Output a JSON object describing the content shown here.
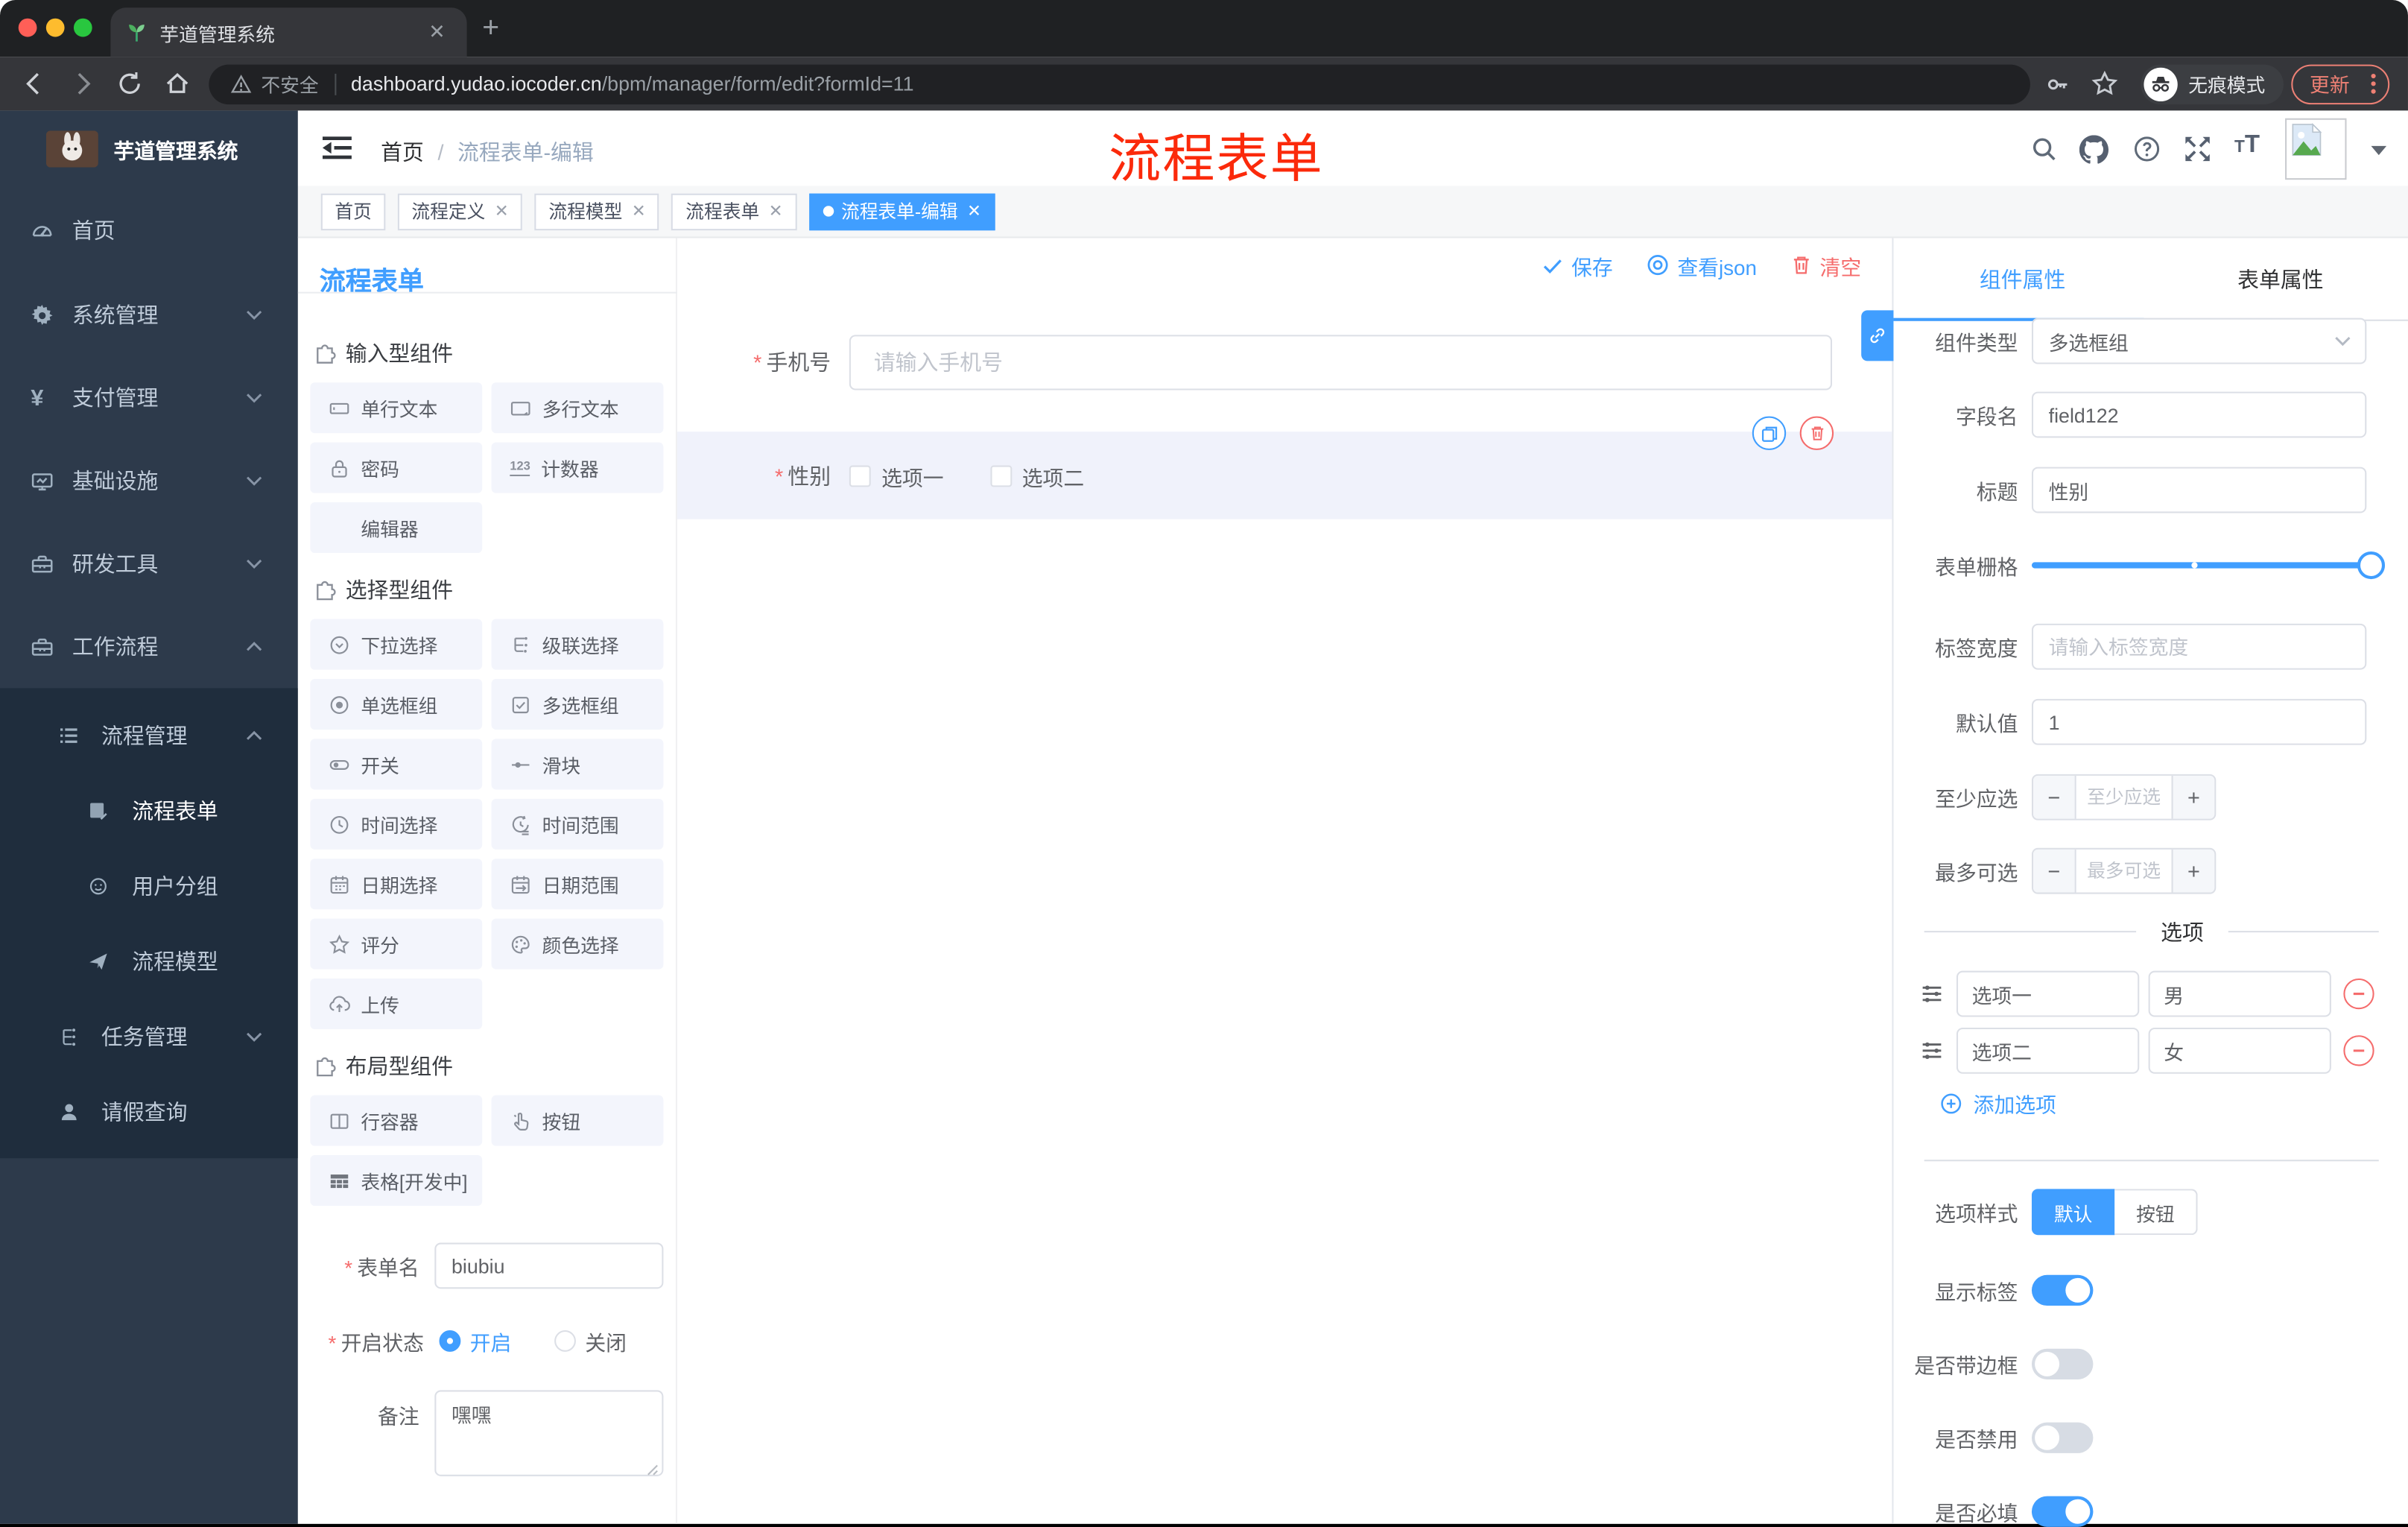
{
  "browser": {
    "tab_title": "芋道管理系统",
    "security_label": "不安全",
    "url_host": "dashboard.yudao.iocoder.cn",
    "url_path": "/bpm/manager/form/edit?formId=11",
    "incognito_label": "无痕模式",
    "update_label": "更新"
  },
  "sidebar": {
    "logo_title": "芋道管理系统",
    "items": [
      {
        "label": "首页"
      },
      {
        "label": "系统管理"
      },
      {
        "label": "支付管理"
      },
      {
        "label": "基础设施"
      },
      {
        "label": "研发工具"
      },
      {
        "label": "工作流程"
      }
    ],
    "submenu": [
      {
        "label": "流程管理"
      },
      {
        "label": "流程表单"
      },
      {
        "label": "用户分组"
      },
      {
        "label": "流程模型"
      },
      {
        "label": "任务管理"
      },
      {
        "label": "请假查询"
      }
    ]
  },
  "header": {
    "breadcrumb_home": "首页",
    "breadcrumb_current": "流程表单-编辑",
    "overlay_title": "流程表单"
  },
  "tags": [
    {
      "label": "首页"
    },
    {
      "label": "流程定义"
    },
    {
      "label": "流程模型"
    },
    {
      "label": "流程表单"
    },
    {
      "label": "流程表单-编辑"
    }
  ],
  "palette": {
    "title": "流程表单",
    "section_input": {
      "title": "输入型组件",
      "items": [
        "单行文本",
        "多行文本",
        "密码",
        "计数器",
        "编辑器"
      ]
    },
    "section_select": {
      "title": "选择型组件",
      "items": [
        "下拉选择",
        "级联选择",
        "单选框组",
        "多选框组",
        "开关",
        "滑块",
        "时间选择",
        "时间范围",
        "日期选择",
        "日期范围",
        "评分",
        "颜色选择",
        "上传"
      ]
    },
    "section_layout": {
      "title": "布局型组件",
      "items": [
        "行容器",
        "按钮",
        "表格[开发中]"
      ]
    },
    "form": {
      "name_label": "表单名",
      "name_value": "biubiu",
      "status_label": "开启状态",
      "status_on": "开启",
      "status_off": "关闭",
      "remark_label": "备注",
      "remark_value": "嘿嘿"
    }
  },
  "canvas": {
    "save_label": "保存",
    "view_json_label": "查看json",
    "clear_label": "清空",
    "phone_label": "手机号",
    "phone_placeholder": "请输入手机号",
    "gender_label": "性别",
    "gender_option1": "选项一",
    "gender_option2": "选项二"
  },
  "inspector": {
    "tab_component": "组件属性",
    "tab_form": "表单属性",
    "type_label": "组件类型",
    "type_value": "多选框组",
    "field_label": "字段名",
    "field_value": "field122",
    "title_label": "标题",
    "title_value": "性别",
    "grid_label": "表单栅格",
    "label_width_label": "标签宽度",
    "label_width_placeholder": "请输入标签宽度",
    "default_label": "默认值",
    "default_value": "1",
    "min_label": "至少应选",
    "min_placeholder": "至少应选",
    "max_label": "最多可选",
    "max_placeholder": "最多可选",
    "options_title": "选项",
    "options": [
      {
        "label": "选项一",
        "value": "男"
      },
      {
        "label": "选项二",
        "value": "女"
      }
    ],
    "add_option_label": "添加选项",
    "style_label": "选项样式",
    "style_default": "默认",
    "style_button": "按钮",
    "show_label_label": "显示标签",
    "border_label": "是否带边框",
    "disabled_label": "是否禁用",
    "required_label": "是否必填"
  },
  "colors": {
    "accent": "#409eff",
    "danger": "#f56c6c",
    "overlay_red": "#fb2a0b",
    "sidebar_bg": "#2d3a4b",
    "submenu_bg": "#1f2d3d"
  }
}
